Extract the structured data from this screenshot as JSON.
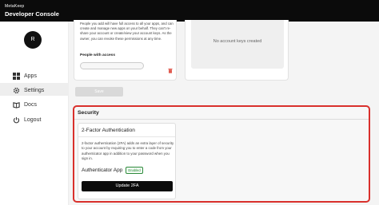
{
  "header": {
    "brand": "MetaKeep",
    "title": "Developer Console"
  },
  "sidebar": {
    "avatar_initial": "R",
    "items": [
      {
        "label": "Apps",
        "icon": "grid-icon"
      },
      {
        "label": "Settings",
        "icon": "gear-icon",
        "active": true
      },
      {
        "label": "Docs",
        "icon": "book-icon"
      },
      {
        "label": "Logout",
        "icon": "power-icon"
      }
    ]
  },
  "access_card": {
    "description": "People you add will have full access to all your apps, and can create and manage new apps on your behalf. They can't re-share your account or create/view your account keys. As the owner, you can revoke these permissions at any time.",
    "heading": "People with access",
    "input_value": "",
    "save_label": "Save"
  },
  "keys_card": {
    "empty_text": "No account keys created"
  },
  "security": {
    "title": "Security",
    "twofa": {
      "title": "2-Factor Authentication",
      "description": "2-factor authentication (2FA) adds an extra layer of security to your account by requiring you to enter a code from your authenticator app in addition to your password when you sign in.",
      "method_label": "Authenticator App",
      "status": "Enabled",
      "button_label": "Update 2FA"
    }
  },
  "colors": {
    "highlight_border": "#d9302c",
    "enabled_green": "#2e8b3c",
    "topbar": "#0b0b0b"
  }
}
